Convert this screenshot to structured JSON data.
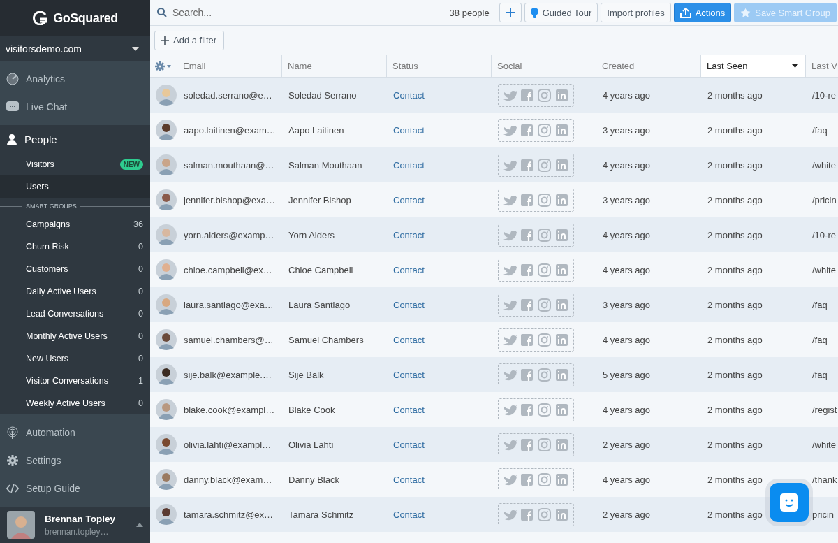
{
  "sidebar": {
    "logo": "GoSquared",
    "site": "visitorsdemo.com",
    "top_items": [
      {
        "kind": "analytics",
        "label": "Analytics"
      },
      {
        "kind": "chat",
        "label": "Live Chat"
      }
    ],
    "people": {
      "label": "People",
      "items": [
        {
          "label": "Visitors",
          "badge": "NEW",
          "selected": false
        },
        {
          "label": "Users",
          "selected": true
        }
      ]
    },
    "smart_groups_heading": "SMART GROUPS",
    "smart_groups": [
      {
        "label": "Campaigns",
        "count": "36"
      },
      {
        "label": "Churn Risk",
        "count": "0"
      },
      {
        "label": "Customers",
        "count": "0"
      },
      {
        "label": "Daily Active Users",
        "count": "0"
      },
      {
        "label": "Lead Conversations",
        "count": "0"
      },
      {
        "label": "Monthly Active Users",
        "count": "0"
      },
      {
        "label": "New Users",
        "count": "0"
      },
      {
        "label": "Visitor Conversations",
        "count": "1"
      },
      {
        "label": "Weekly Active Users",
        "count": "0"
      }
    ],
    "bottom_items": [
      {
        "kind": "automation",
        "label": "Automation"
      },
      {
        "kind": "settings",
        "label": "Settings"
      },
      {
        "kind": "code",
        "label": "Setup Guide"
      }
    ],
    "user": {
      "name": "Brennan Topley",
      "email": "brennan.topley…"
    }
  },
  "toolbar": {
    "search": {
      "placeholder": "Search..."
    },
    "count": "38 people",
    "buttons": [
      {
        "kind": "plus",
        "disabled": false
      },
      {
        "kind": "tour",
        "label": "Guided Tour",
        "disabled": false
      },
      {
        "kind": "plain",
        "label": "Import profiles",
        "disabled": false
      },
      {
        "kind": "primary",
        "label": "Actions",
        "disabled": false
      },
      {
        "kind": "star",
        "label": "Save Smart Group",
        "disabled": true
      }
    ]
  },
  "filter_button": "Add a filter",
  "table": {
    "columns": [
      {
        "label": "Email",
        "sorted": false
      },
      {
        "label": "Name",
        "sorted": false
      },
      {
        "label": "Status",
        "sorted": false
      },
      {
        "label": "Social",
        "sorted": false
      },
      {
        "label": "Created",
        "sorted": false
      },
      {
        "label": "Last Seen",
        "sorted": true
      },
      {
        "label": "Last V",
        "sorted": false
      }
    ],
    "rows": [
      {
        "email": "soledad.serrano@e…",
        "name": "Soledad Serrano",
        "status": "Contact",
        "created": "4 years ago",
        "last_seen": "2 months ago",
        "last_page": "/10-re"
      },
      {
        "email": "aapo.laitinen@exam…",
        "name": "Aapo Laitinen",
        "status": "Contact",
        "created": "3 years ago",
        "last_seen": "2 months ago",
        "last_page": "/faq"
      },
      {
        "email": "salman.mouthaan@…",
        "name": "Salman Mouthaan",
        "status": "Contact",
        "created": "4 years ago",
        "last_seen": "2 months ago",
        "last_page": "/white"
      },
      {
        "email": "jennifer.bishop@exa…",
        "name": "Jennifer Bishop",
        "status": "Contact",
        "created": "3 years ago",
        "last_seen": "2 months ago",
        "last_page": "/pricin"
      },
      {
        "email": "yorn.alders@examp…",
        "name": "Yorn Alders",
        "status": "Contact",
        "created": "4 years ago",
        "last_seen": "2 months ago",
        "last_page": "/10-re"
      },
      {
        "email": "chloe.campbell@ex…",
        "name": "Chloe Campbell",
        "status": "Contact",
        "created": "4 years ago",
        "last_seen": "2 months ago",
        "last_page": "/white"
      },
      {
        "email": "laura.santiago@exa…",
        "name": "Laura Santiago",
        "status": "Contact",
        "created": "3 years ago",
        "last_seen": "2 months ago",
        "last_page": "/faq"
      },
      {
        "email": "samuel.chambers@…",
        "name": "Samuel Chambers",
        "status": "Contact",
        "created": "4 years ago",
        "last_seen": "2 months ago",
        "last_page": "/faq"
      },
      {
        "email": "sije.balk@example.…",
        "name": "Sije Balk",
        "status": "Contact",
        "created": "5 years ago",
        "last_seen": "2 months ago",
        "last_page": "/faq"
      },
      {
        "email": "blake.cook@exampl…",
        "name": "Blake Cook",
        "status": "Contact",
        "created": "4 years ago",
        "last_seen": "2 months ago",
        "last_page": "/regist"
      },
      {
        "email": "olivia.lahti@exampl…",
        "name": "Olivia Lahti",
        "status": "Contact",
        "created": "2 years ago",
        "last_seen": "2 months ago",
        "last_page": "/white"
      },
      {
        "email": "danny.black@exam…",
        "name": "Danny Black",
        "status": "Contact",
        "created": "4 years ago",
        "last_seen": "2 months ago",
        "last_page": "/thank"
      },
      {
        "email": "tamara.schmitz@ex…",
        "name": "Tamara Schmitz",
        "status": "Contact",
        "created": "2 years ago",
        "last_seen": "2 months ago",
        "last_page": "pricin"
      }
    ]
  }
}
